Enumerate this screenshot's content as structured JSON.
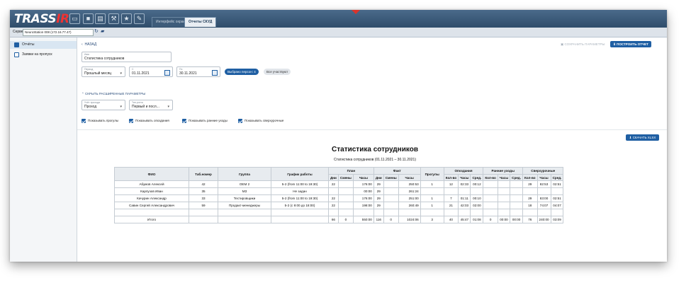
{
  "app": {
    "logo_main": "TRASS",
    "logo_accent": "IR",
    "tabs": [
      "Интерфейс охраны",
      "Отчеты СКУД"
    ]
  },
  "server_bar": {
    "label": "Сервер",
    "server_value": "NeuroStation 008 (172.16.77.47)"
  },
  "sidebar": {
    "items": [
      {
        "label": "Отчёты",
        "icon": "report-icon"
      },
      {
        "label": "Заявки на пропуск",
        "icon": "pass-request-icon"
      }
    ]
  },
  "toolbar": {
    "back_label": "НАЗАД",
    "save_preset_label": "СОХРАНИТЬ ПАРАМЕТРЫ",
    "build_label": "ПОСТРОИТЬ ОТЧЕТ"
  },
  "form": {
    "name_label": "Имя",
    "name_value": "Статистика сотрудников",
    "period_label": "Период",
    "period_value": "Прошлый месяц",
    "from_label": "С",
    "from_value": "01.11.2021",
    "to_label": "По",
    "to_value": "30.11.2021",
    "selected_persons": "Выбрано персон: 4",
    "all_attendees": "Все участвуют",
    "advanced_toggle": "СКРЫТЬ РАСШИРЕННЫЕ ПАРАМЕТРЫ",
    "event_label": "Учёт прохода",
    "event_value": "Проход",
    "mode_label": "Тип учета",
    "mode_value": "Первый и посл..."
  },
  "checkboxes": [
    "Показывать прогулы",
    "Показывать опоздания",
    "Показывать ранние уходы",
    "Показывать сверхурочные"
  ],
  "report": {
    "download_label": "СКАЧАТЬ XLSX",
    "title": "Статистика сотрудников",
    "subtitle": "Статистика сотрудников (01.11.2021 – 30.11.2021)",
    "headers": {
      "fio": "ФИО",
      "tab": "Таб.номер",
      "group": "Группа",
      "schedule": "График работы",
      "plan": "План",
      "fact": "Факт",
      "absences": "Прогулы",
      "late": "Опоздания",
      "early": "Ранние уходы",
      "overtime": "Сверхурочные",
      "days": "Дни",
      "shifts": "Смены",
      "hours": "Часы",
      "count": "Кол-во",
      "avg": "Сред."
    },
    "rows": [
      {
        "fio": "Абумов Алексей",
        "tab": "42",
        "group": "ОЕМ 2",
        "schedule": "5-2 (from 11:00 to 19:30)",
        "plan_days": "22",
        "plan_shifts": "",
        "plan_hours": "176:00",
        "fact_days": "29",
        "fact_shifts": "",
        "fact_hours": "250:53",
        "absences": "1",
        "late_count": "12",
        "late_hours": "02:33",
        "late_avg": "00:12",
        "early_count": "",
        "early_hours": "",
        "early_avg": "",
        "ot_count": "29",
        "ot_hours": "82:53",
        "ot_avg": "02:51"
      },
      {
        "fio": "Карпузов Иван",
        "tab": "35",
        "group": "МЗ",
        "schedule": "Не задан",
        "plan_days": "",
        "plan_shifts": "",
        "plan_hours": "00:00",
        "fact_days": "29",
        "fact_shifts": "",
        "fact_hours": "261:24",
        "absences": "",
        "late_count": "",
        "late_hours": "",
        "late_avg": "",
        "early_count": "",
        "early_hours": "",
        "early_avg": "",
        "ot_count": "",
        "ot_hours": "",
        "ot_avg": ""
      },
      {
        "fio": "Качурин Александр",
        "tab": "33",
        "group": "Тестировщики",
        "schedule": "5-2 (from 11:00 to 19:30)",
        "plan_days": "22",
        "plan_shifts": "",
        "plan_hours": "176:00",
        "fact_days": "29",
        "fact_shifts": "",
        "fact_hours": "251:00",
        "absences": "1",
        "late_count": "7",
        "late_hours": "01:11",
        "late_avg": "00:10",
        "early_count": "",
        "early_hours": "",
        "early_avg": "",
        "ot_count": "29",
        "ot_hours": "83:00",
        "ot_avg": "02:51"
      },
      {
        "fio": "Савин Сергей Александрович",
        "tab": "59",
        "group": "Продакт-менеджеры",
        "schedule": "5-2 (с 9:00 до 18:00)",
        "plan_days": "22",
        "plan_shifts": "",
        "plan_hours": "198:00",
        "fact_days": "29",
        "fact_shifts": "",
        "fact_hours": "260:49",
        "absences": "1",
        "late_count": "21",
        "late_hours": "42:03",
        "late_avg": "02:00",
        "early_count": "",
        "early_hours": "",
        "early_avg": "",
        "ot_count": "18",
        "ot_hours": "74:07",
        "ot_avg": "04:07"
      }
    ],
    "total": {
      "fio": "Итого",
      "plan_days": "66",
      "plan_shifts": "0",
      "plan_hours": "550:00",
      "fact_days": "116",
      "fact_shifts": "0",
      "fact_hours": "1024:06",
      "absences": "3",
      "late_count": "40",
      "late_hours": "45:47",
      "late_avg": "01:08",
      "early_count": "0",
      "early_hours": "00:00",
      "early_avg": "00:00",
      "ot_count": "76",
      "ot_hours": "240:00",
      "ot_avg": "03:09"
    }
  }
}
